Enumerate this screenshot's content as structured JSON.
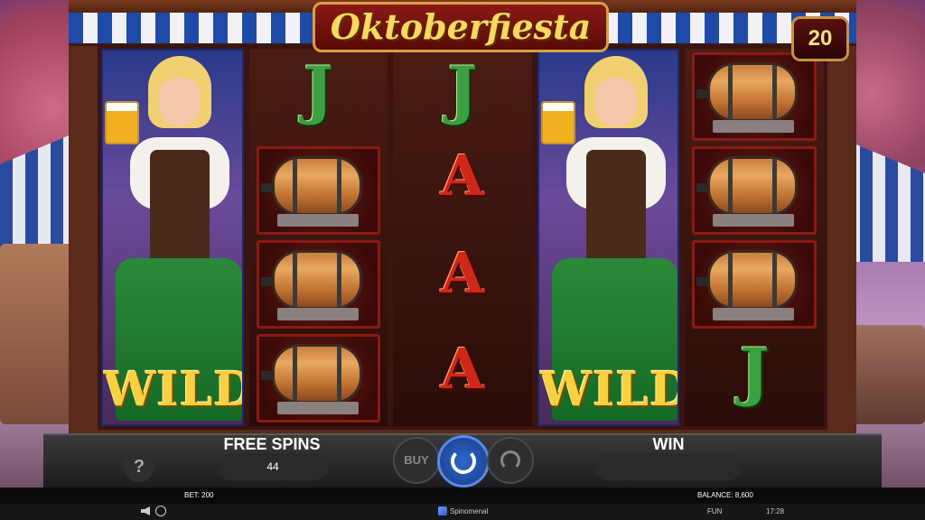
{
  "game": {
    "title": "Oktoberfiesta",
    "free_spins_counter": "20",
    "free_spins_label": "FREE SPINS",
    "free_spins_value": "44",
    "win_label": "WIN",
    "win_value": "",
    "wild_label": "WILD",
    "buy_label": "BUY",
    "help_label": "?"
  },
  "reels": [
    {
      "type": "wild"
    },
    {
      "symbols": [
        "J",
        "barrel",
        "barrel",
        "barrel"
      ]
    },
    {
      "symbols": [
        "J",
        "A",
        "A",
        "A"
      ]
    },
    {
      "type": "wild"
    },
    {
      "symbols": [
        "barrel",
        "barrel",
        "barrel",
        "J"
      ]
    }
  ],
  "status": {
    "bet": "BET: 200",
    "balance": "BALANCE: 8,600",
    "mode": "FUN",
    "time": "17:28",
    "provider": "Spinomenal"
  },
  "colors": {
    "spin_button": "#2a6ac8",
    "panel": "#1c1c1e",
    "title_text": "#f8d860"
  }
}
